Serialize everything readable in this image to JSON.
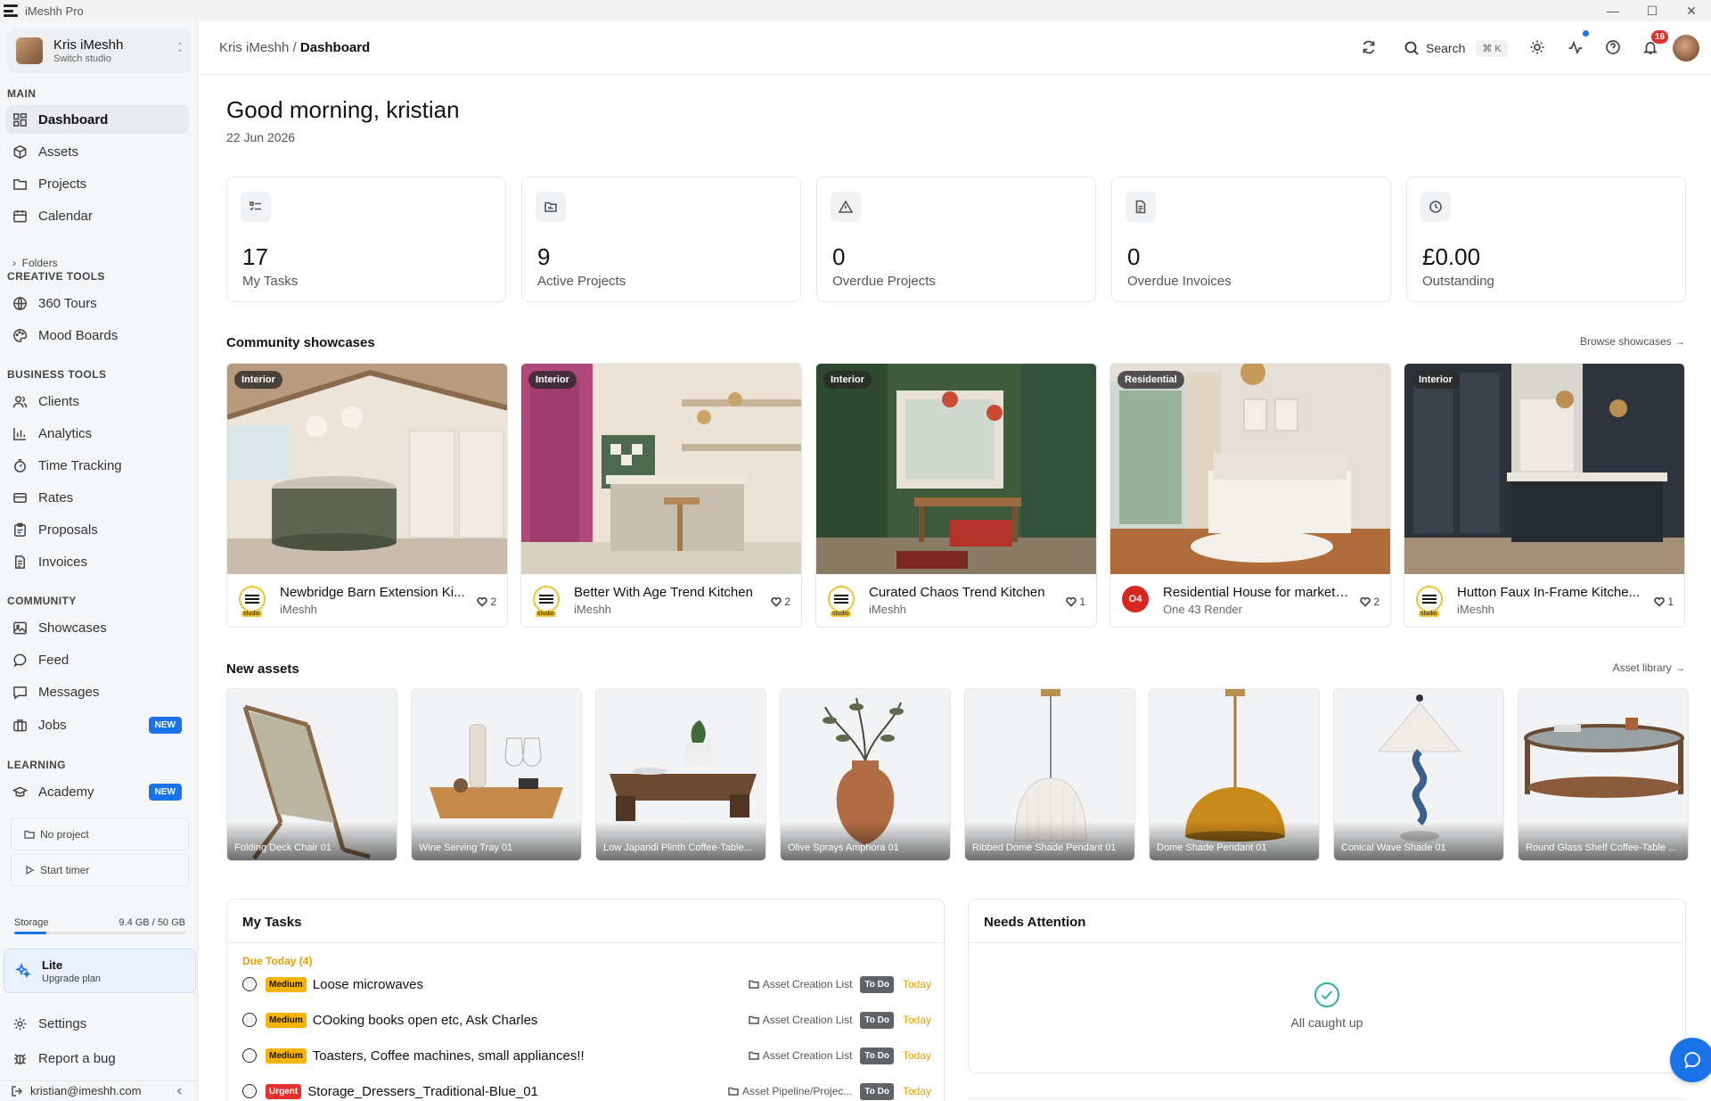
{
  "window": {
    "title": "iMeshh Pro"
  },
  "sidebar": {
    "studio_name": "Kris iMeshh",
    "studio_sub": "Switch studio",
    "sections": {
      "main": "MAIN",
      "creative": "CREATIVE TOOLS",
      "business": "BUSINESS TOOLS",
      "community": "COMMUNITY",
      "learning": "LEARNING"
    },
    "main_items": [
      {
        "label": "Dashboard",
        "icon": "dashboard-icon"
      },
      {
        "label": "Assets",
        "icon": "cube-icon"
      },
      {
        "label": "Projects",
        "icon": "folder-icon"
      },
      {
        "label": "Calendar",
        "icon": "calendar-icon"
      }
    ],
    "folders_label": "Folders",
    "creative_items": [
      {
        "label": "360 Tours",
        "icon": "globe-icon"
      },
      {
        "label": "Mood Boards",
        "icon": "palette-icon"
      }
    ],
    "business_items": [
      {
        "label": "Clients",
        "icon": "users-icon"
      },
      {
        "label": "Analytics",
        "icon": "bar-chart-icon"
      },
      {
        "label": "Time Tracking",
        "icon": "timer-icon"
      },
      {
        "label": "Rates",
        "icon": "card-icon"
      },
      {
        "label": "Proposals",
        "icon": "clipboard-icon"
      },
      {
        "label": "Invoices",
        "icon": "document-icon"
      }
    ],
    "community_items": [
      {
        "label": "Showcases",
        "icon": "image-icon"
      },
      {
        "label": "Feed",
        "icon": "chat-bubble-icon"
      },
      {
        "label": "Messages",
        "icon": "message-icon"
      },
      {
        "label": "Jobs",
        "icon": "briefcase-icon",
        "badge": "NEW"
      }
    ],
    "learning_items": [
      {
        "label": "Academy",
        "icon": "graduation-cap-icon",
        "badge": "NEW"
      }
    ],
    "timer_project": "No project",
    "timer_start": "Start timer",
    "storage_label": "Storage",
    "storage_value": "9.4 GB / 50 GB",
    "storage_fraction": 0.188,
    "plan_name": "Lite",
    "plan_sub": "Upgrade plan",
    "settings": "Settings",
    "report_bug": "Report a bug",
    "user_email": "kristian@imeshh.com"
  },
  "header": {
    "breadcrumb_parent": "Kris iMeshh",
    "breadcrumb_sep": " / ",
    "breadcrumb_current": "Dashboard",
    "search_label": "Search",
    "search_shortcut": "⌘ K",
    "notification_count": "16"
  },
  "dashboard": {
    "greeting": "Good morning, kristian",
    "date": "22 Jun 2026",
    "stats": [
      {
        "value": "17",
        "label": "My Tasks",
        "icon": "tasks-icon"
      },
      {
        "value": "9",
        "label": "Active Projects",
        "icon": "folder-icon"
      },
      {
        "value": "0",
        "label": "Overdue Projects",
        "icon": "warning-icon"
      },
      {
        "value": "0",
        "label": "Overdue Invoices",
        "icon": "invoice-icon"
      },
      {
        "value": "£0.00",
        "label": "Outstanding",
        "icon": "clock-icon"
      }
    ],
    "showcases_title": "Community showcases",
    "showcases_link": "Browse showcases →",
    "showcases": [
      {
        "tag": "Interior",
        "title": "Newbridge Barn Extension Ki...",
        "author": "iMeshh",
        "likes": "2",
        "avatar": "imeshh-logo"
      },
      {
        "tag": "Interior",
        "title": "Better With Age Trend Kitchen",
        "author": "iMeshh",
        "likes": "2",
        "avatar": "imeshh-logo"
      },
      {
        "tag": "Interior",
        "title": "Curated Chaos Trend Kitchen",
        "author": "iMeshh",
        "likes": "1",
        "avatar": "imeshh-logo"
      },
      {
        "tag": "Residential",
        "title": "Residential House for marketing",
        "author": "One 43 Render",
        "likes": "2",
        "avatar": "one43-logo",
        "avatar_text": "O4"
      },
      {
        "tag": "Interior",
        "title": "Hutton Faux In-Frame Kitche...",
        "author": "iMeshh",
        "likes": "1",
        "avatar": "imeshh-logo"
      }
    ],
    "avatar_studio_tag": "studio",
    "assets_title": "New assets",
    "assets_link": "Asset library →",
    "assets": [
      "Folding Deck Chair 01",
      "Wine Serving Tray 01",
      "Low Japandi Plinth Coffee-Table...",
      "Olive Sprays Amphora 01",
      "Ribbed Dome Shade Pendant 01",
      "Dome Shade Pendant 01",
      "Conical Wave Shade 01",
      "Round Glass Shelf Coffee-Table ..."
    ],
    "tasks_title": "My Tasks",
    "due_today": "Due Today (4)",
    "tasks": [
      {
        "priority": "Medium",
        "name": "Loose microwaves",
        "project": "Asset Creation List",
        "status": "To Do",
        "when": "Today"
      },
      {
        "priority": "Medium",
        "name": "COoking books open etc, Ask Charles",
        "project": "Asset Creation List",
        "status": "To Do",
        "when": "Today"
      },
      {
        "priority": "Medium",
        "name": "Toasters, Coffee machines, small appliances!!",
        "project": "Asset Creation List",
        "status": "To Do",
        "when": "Today"
      },
      {
        "priority": "Urgent",
        "name": "Storage_Dressers_Traditional-Blue_01",
        "project": "Asset Pipeline/Projec...",
        "status": "To Do",
        "when": "Today"
      }
    ],
    "attention_title": "Needs Attention",
    "attention_empty": "All caught up"
  },
  "colors": {
    "accent": "#1a73e8",
    "warning": "#f5b400",
    "urgent": "#e5302e",
    "success": "#2bb38f"
  }
}
